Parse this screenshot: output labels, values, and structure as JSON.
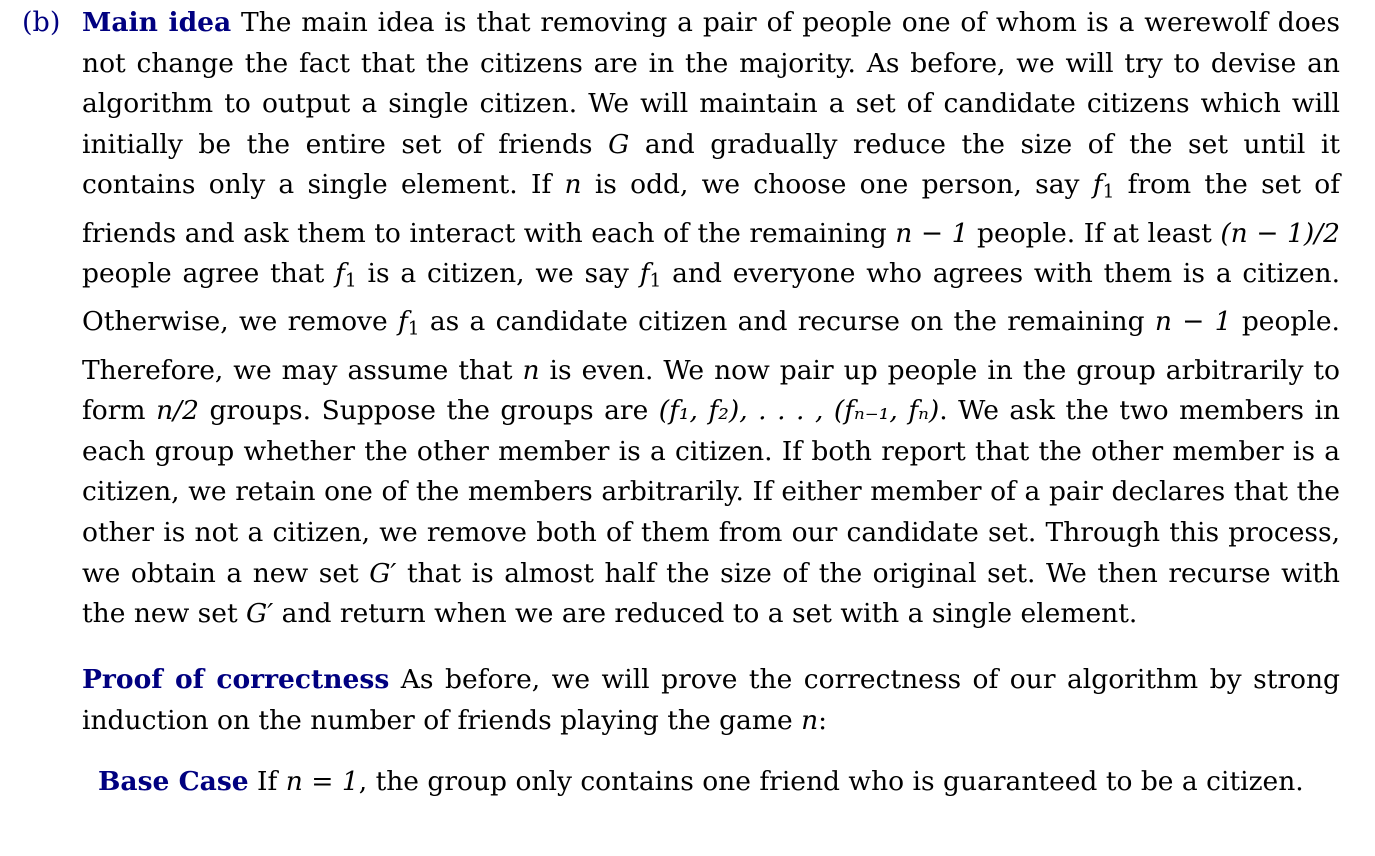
{
  "item_label": "(b)",
  "main_idea": {
    "heading": "Main idea",
    "text_1": " The main idea is that removing a pair of people one of whom is a werewolf does not change the fact that the citizens are in the majority. As before, we will try to devise an algorithm to output a single citizen. We will maintain a set of candidate citizens which will initially be the entire set of friends ",
    "m_G": "G",
    "text_2": " and gradually reduce the size of the set until it contains only a single element. If ",
    "m_n1": "n",
    "text_3": " is odd, we choose one person, say ",
    "m_f1a": "f",
    "s_1a": "1",
    "text_4": " from the set of friends and ask them to interact with each of the remaining ",
    "m_n2": "n − 1",
    "text_5": " people. If at least ",
    "m_n3": "(n − 1)/2",
    "text_6": " people agree that ",
    "m_f1b": "f",
    "s_1b": "1",
    "text_7": " is a citizen, we say ",
    "m_f1c": "f",
    "s_1c": "1",
    "text_8": " and everyone who agrees with them is a citizen. Otherwise, we remove ",
    "m_f1d": "f",
    "s_1d": "1",
    "text_9": " as a candidate citizen and recurse on the remaining ",
    "m_n4": "n − 1",
    "text_10": " people. Therefore, we may assume that ",
    "m_n5": "n",
    "text_11": " is even. We now pair up people in the group arbitrarily to form ",
    "m_n6": "n/2",
    "text_12": " groups. Suppose the groups are ",
    "m_pairs": "(f₁, f₂), . . . , (fₙ₋₁, fₙ)",
    "text_13": ". We ask the two members in each group whether the other member is a citizen. If both report that the other member is a citizen, we retain one of the members arbitrarily. If either member of a pair declares that the other is not a citizen, we remove both of them from our candidate set. Through this process, we obtain a new set ",
    "m_Gp1": "G′",
    "text_14": " that is almost half the size of the original set. We then recurse with the new set ",
    "m_Gp2": "G′",
    "text_15": " and return when we are reduced to a set with a single element."
  },
  "proof": {
    "heading": "Proof of correctness",
    "text_1": " As before, we will prove the correctness of our algorithm by strong induction on the number of friends playing the game ",
    "m_n": "n",
    "text_2": ":"
  },
  "base_case": {
    "heading": "Base Case",
    "text_1": " If ",
    "m_eq": "n = 1",
    "text_2": ", the group only contains one friend who is guaranteed to be a citizen."
  }
}
